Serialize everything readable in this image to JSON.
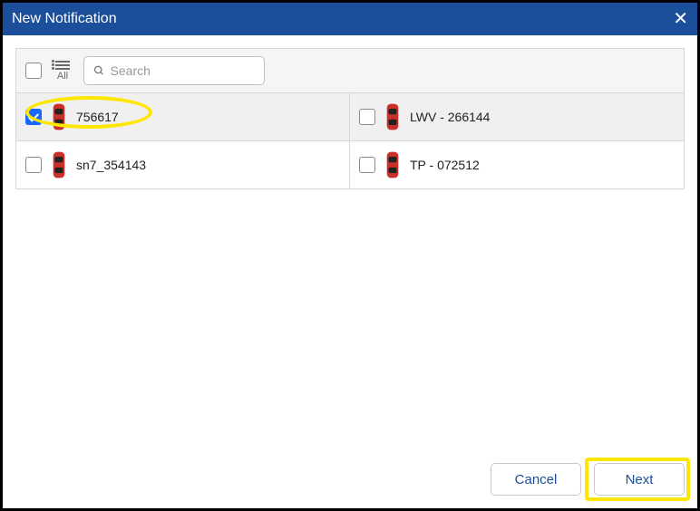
{
  "titlebar": {
    "title": "New Notification"
  },
  "toolbar": {
    "all_label": "All",
    "search_placeholder": "Search"
  },
  "items": [
    {
      "label": "756617",
      "checked": true,
      "highlighted": true
    },
    {
      "label": "LWV - 266144",
      "checked": false,
      "highlighted": false
    },
    {
      "label": "sn7_354143",
      "checked": false,
      "highlighted": false
    },
    {
      "label": "TP - 072512",
      "checked": false,
      "highlighted": false
    }
  ],
  "footer": {
    "cancel_label": "Cancel",
    "next_label": "Next"
  }
}
